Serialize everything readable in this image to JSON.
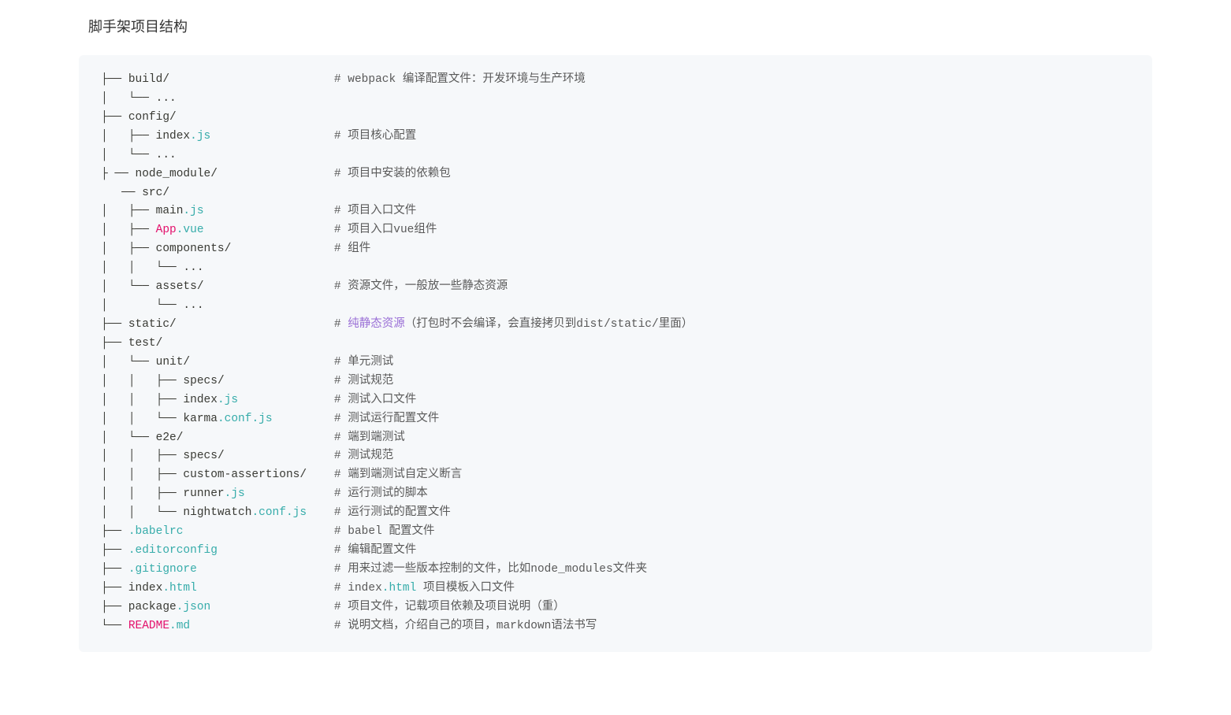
{
  "heading": "脚手架项目结构",
  "tree_lines": [
    {
      "segments": [
        {
          "t": "├── ",
          "c": "path"
        },
        {
          "t": "build",
          "c": "path"
        },
        {
          "t": "/                        ",
          "c": "path"
        },
        {
          "t": "# webpack 编译配置文件：开发环境与生产环境",
          "c": "cmt"
        }
      ]
    },
    {
      "segments": [
        {
          "t": "│   └── ...",
          "c": "path"
        }
      ]
    },
    {
      "segments": [
        {
          "t": "├── ",
          "c": "path"
        },
        {
          "t": "config",
          "c": "path"
        },
        {
          "t": "/",
          "c": "path"
        }
      ]
    },
    {
      "segments": [
        {
          "t": "│   ├── index",
          "c": "path"
        },
        {
          "t": ".js",
          "c": "attr"
        },
        {
          "t": "                  ",
          "c": "path"
        },
        {
          "t": "# 项目核心配置",
          "c": "cmt"
        }
      ]
    },
    {
      "segments": [
        {
          "t": "│   └── ...",
          "c": "path"
        }
      ]
    },
    {
      "segments": [
        {
          "t": "├ ── ",
          "c": "path"
        },
        {
          "t": "node_module",
          "c": "path"
        },
        {
          "t": "/                 ",
          "c": "path"
        },
        {
          "t": "# 项目中安装的依赖包",
          "c": "cmt"
        }
      ]
    },
    {
      "segments": [
        {
          "t": "   ── ",
          "c": "path"
        },
        {
          "t": "src",
          "c": "path"
        },
        {
          "t": "/",
          "c": "path"
        }
      ]
    },
    {
      "segments": [
        {
          "t": "│   ├── main",
          "c": "path"
        },
        {
          "t": ".js",
          "c": "attr"
        },
        {
          "t": "                   ",
          "c": "path"
        },
        {
          "t": "# 项目入口文件",
          "c": "cmt"
        }
      ]
    },
    {
      "segments": [
        {
          "t": "│   ├── ",
          "c": "path"
        },
        {
          "t": "App",
          "c": "str"
        },
        {
          "t": ".vue",
          "c": "attr"
        },
        {
          "t": "                   ",
          "c": "path"
        },
        {
          "t": "# 项目入口vue组件",
          "c": "cmt"
        }
      ]
    },
    {
      "segments": [
        {
          "t": "│   ├── components",
          "c": "path"
        },
        {
          "t": "/               ",
          "c": "path"
        },
        {
          "t": "# 组件",
          "c": "cmt"
        }
      ]
    },
    {
      "segments": [
        {
          "t": "│   │   └── ...",
          "c": "path"
        }
      ]
    },
    {
      "segments": [
        {
          "t": "│   └── assets",
          "c": "path"
        },
        {
          "t": "/                   ",
          "c": "path"
        },
        {
          "t": "# 资源文件，一般放一些静态资源",
          "c": "cmt"
        }
      ]
    },
    {
      "segments": [
        {
          "t": "│       └── ...",
          "c": "path"
        }
      ]
    },
    {
      "segments": [
        {
          "t": "├── ",
          "c": "path"
        },
        {
          "t": "static",
          "c": "path"
        },
        {
          "t": "/                       ",
          "c": "path"
        },
        {
          "t": "# ",
          "c": "cmt"
        },
        {
          "t": "纯静态资源",
          "c": "hl"
        },
        {
          "t": "（打包时不会编译，会直接拷贝到dist/static/里面）",
          "c": "cmt"
        }
      ]
    },
    {
      "segments": [
        {
          "t": "├── ",
          "c": "path"
        },
        {
          "t": "test",
          "c": "path"
        },
        {
          "t": "/",
          "c": "path"
        }
      ]
    },
    {
      "segments": [
        {
          "t": "│   └── unit",
          "c": "path"
        },
        {
          "t": "/                     ",
          "c": "path"
        },
        {
          "t": "# 单元测试",
          "c": "cmt"
        }
      ]
    },
    {
      "segments": [
        {
          "t": "│   │   ├── specs",
          "c": "path"
        },
        {
          "t": "/                ",
          "c": "path"
        },
        {
          "t": "# 测试规范",
          "c": "cmt"
        }
      ]
    },
    {
      "segments": [
        {
          "t": "│   │   ├── index",
          "c": "path"
        },
        {
          "t": ".js",
          "c": "attr"
        },
        {
          "t": "              ",
          "c": "path"
        },
        {
          "t": "# 测试入口文件",
          "c": "cmt"
        }
      ]
    },
    {
      "segments": [
        {
          "t": "│   │   └── karma",
          "c": "path"
        },
        {
          "t": ".conf",
          "c": "attr"
        },
        {
          "t": ".js",
          "c": "attr"
        },
        {
          "t": "         ",
          "c": "path"
        },
        {
          "t": "# 测试运行配置文件",
          "c": "cmt"
        }
      ]
    },
    {
      "segments": [
        {
          "t": "│   └── e2e",
          "c": "path"
        },
        {
          "t": "/                      ",
          "c": "path"
        },
        {
          "t": "# 端到端测试",
          "c": "cmt"
        }
      ]
    },
    {
      "segments": [
        {
          "t": "│   │   ├── specs",
          "c": "path"
        },
        {
          "t": "/                ",
          "c": "path"
        },
        {
          "t": "# 测试规范",
          "c": "cmt"
        }
      ]
    },
    {
      "segments": [
        {
          "t": "│   │   ├── custom-assertions",
          "c": "path"
        },
        {
          "t": "/    ",
          "c": "path"
        },
        {
          "t": "# 端到端测试自定义断言",
          "c": "cmt"
        }
      ]
    },
    {
      "segments": [
        {
          "t": "│   │   ├── runner",
          "c": "path"
        },
        {
          "t": ".js",
          "c": "attr"
        },
        {
          "t": "             ",
          "c": "path"
        },
        {
          "t": "# 运行测试的脚本",
          "c": "cmt"
        }
      ]
    },
    {
      "segments": [
        {
          "t": "│   │   └── nightwatch",
          "c": "path"
        },
        {
          "t": ".conf",
          "c": "attr"
        },
        {
          "t": ".js",
          "c": "attr"
        },
        {
          "t": "    ",
          "c": "path"
        },
        {
          "t": "# 运行测试的配置文件",
          "c": "cmt"
        }
      ]
    },
    {
      "segments": [
        {
          "t": "├── ",
          "c": "path"
        },
        {
          "t": ".babelrc",
          "c": "attr"
        },
        {
          "t": "                      ",
          "c": "path"
        },
        {
          "t": "# babel 配置文件",
          "c": "cmt"
        }
      ]
    },
    {
      "segments": [
        {
          "t": "├── ",
          "c": "path"
        },
        {
          "t": ".editorconfig",
          "c": "attr"
        },
        {
          "t": "                 ",
          "c": "path"
        },
        {
          "t": "# 编辑配置文件",
          "c": "cmt"
        }
      ]
    },
    {
      "segments": [
        {
          "t": "├── ",
          "c": "path"
        },
        {
          "t": ".gitignore",
          "c": "attr"
        },
        {
          "t": "                    ",
          "c": "path"
        },
        {
          "t": "# 用来过滤一些版本控制的文件，比如node_modules文件夹",
          "c": "cmt"
        }
      ]
    },
    {
      "segments": [
        {
          "t": "├── index",
          "c": "path"
        },
        {
          "t": ".html",
          "c": "attr"
        },
        {
          "t": "                    ",
          "c": "path"
        },
        {
          "t": "# index",
          "c": "cmt"
        },
        {
          "t": ".html",
          "c": "attr"
        },
        {
          "t": " 项目模板入口文件",
          "c": "cmt"
        }
      ]
    },
    {
      "segments": [
        {
          "t": "├── package",
          "c": "path"
        },
        {
          "t": ".json",
          "c": "attr"
        },
        {
          "t": "                  ",
          "c": "path"
        },
        {
          "t": "# 项目文件，记载项目依赖及项目说明（重）",
          "c": "cmt"
        }
      ]
    },
    {
      "segments": [
        {
          "t": "└── ",
          "c": "path"
        },
        {
          "t": "README",
          "c": "str"
        },
        {
          "t": ".md",
          "c": "attr"
        },
        {
          "t": "                     ",
          "c": "path"
        },
        {
          "t": "# 说明文档，介绍自己的项目，markdown语法书写",
          "c": "cmt"
        }
      ]
    }
  ]
}
